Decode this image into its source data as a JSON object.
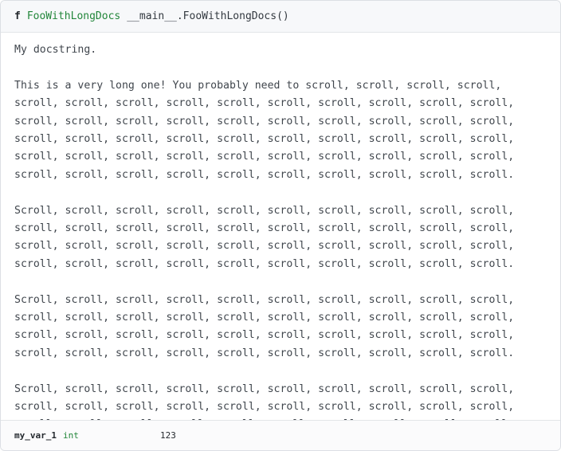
{
  "header": {
    "kind": "f",
    "function_name": "FooWithLongDocs",
    "qualified_name": "__main__.FooWithLongDocs()"
  },
  "docstring": {
    "paragraphs": [
      [
        "My docstring."
      ],
      [
        "This is a very long one! You probably need to scroll, scroll, scroll, scroll,",
        "scroll, scroll, scroll, scroll, scroll, scroll, scroll, scroll, scroll, scroll,",
        "scroll, scroll, scroll, scroll, scroll, scroll, scroll, scroll, scroll, scroll,",
        "scroll, scroll, scroll, scroll, scroll, scroll, scroll, scroll, scroll, scroll,",
        "scroll, scroll, scroll, scroll, scroll, scroll, scroll, scroll, scroll, scroll,",
        "scroll, scroll, scroll, scroll, scroll, scroll, scroll, scroll, scroll, scroll."
      ],
      [
        "Scroll, scroll, scroll, scroll, scroll, scroll, scroll, scroll, scroll, scroll,",
        "scroll, scroll, scroll, scroll, scroll, scroll, scroll, scroll, scroll, scroll,",
        "scroll, scroll, scroll, scroll, scroll, scroll, scroll, scroll, scroll, scroll,",
        "scroll, scroll, scroll, scroll, scroll, scroll, scroll, scroll, scroll, scroll."
      ],
      [
        "Scroll, scroll, scroll, scroll, scroll, scroll, scroll, scroll, scroll, scroll,",
        "scroll, scroll, scroll, scroll, scroll, scroll, scroll, scroll, scroll, scroll,",
        "scroll, scroll, scroll, scroll, scroll, scroll, scroll, scroll, scroll, scroll,",
        "scroll, scroll, scroll, scroll, scroll, scroll, scroll, scroll, scroll, scroll."
      ],
      [
        "Scroll, scroll, scroll, scroll, scroll, scroll, scroll, scroll, scroll, scroll,",
        "scroll, scroll, scroll, scroll, scroll, scroll, scroll, scroll, scroll, scroll,",
        "scroll, scroll, scroll, scroll, scroll, scroll, scroll, scroll, scroll, scroll,"
      ]
    ]
  },
  "variable": {
    "name": "my_var_1",
    "type": "int",
    "value": "123"
  },
  "colors": {
    "function_name": "#22863a",
    "type_name": "#22863a",
    "header_bg": "#f7f8fa",
    "border": "#dcdfe4"
  }
}
